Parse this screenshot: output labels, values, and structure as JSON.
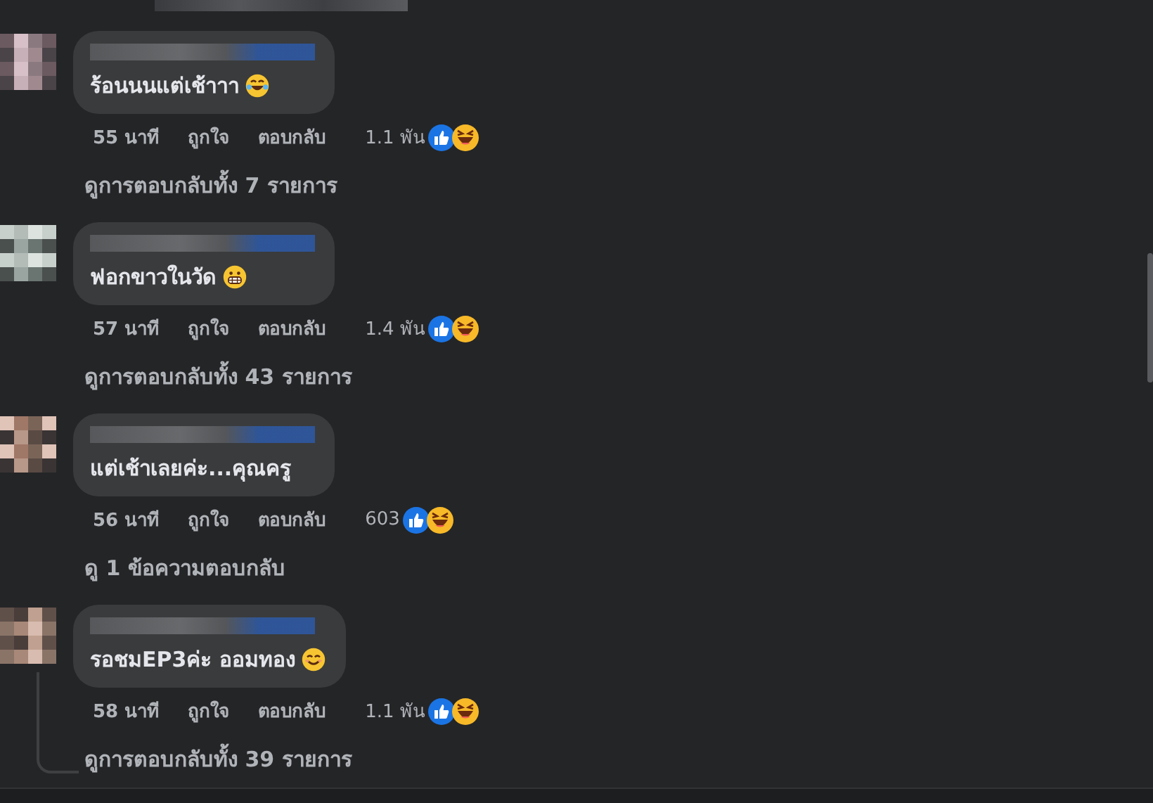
{
  "comments": [
    {
      "text": "ร้อนนนแต่เช้าาา",
      "emoji": {
        "kind": "tears-of-joy"
      },
      "time": "55 นาที",
      "like": "ถูกใจ",
      "reply": "ตอบกลับ",
      "reactions": "1.1 พัน",
      "replies_link": "ดูการตอบกลับทั้ง 7 รายการ",
      "thread_line": false
    },
    {
      "text": "ฟอกขาวในวัด",
      "emoji": {
        "kind": "grimace"
      },
      "time": "57 นาที",
      "like": "ถูกใจ",
      "reply": "ตอบกลับ",
      "reactions": "1.4 พัน",
      "replies_link": "ดูการตอบกลับทั้ง 43 รายการ",
      "thread_line": false
    },
    {
      "text": "แต่เช้าเลยค่ะ...คุณครู",
      "time": "56 นาที",
      "like": "ถูกใจ",
      "reply": "ตอบกลับ",
      "reactions": "603",
      "replies_link": "ดู 1 ข้อความตอบกลับ",
      "thread_line": false
    },
    {
      "text": "รอชมEP3ค่ะ ออมทอง",
      "emoji": {
        "kind": "smile"
      },
      "time": "58 นาที",
      "like": "ถูกใจ",
      "reply": "ตอบกลับ",
      "reactions": "1.1 พัน",
      "replies_link": "ดูการตอบกลับทั้ง 39 รายการ",
      "thread_line": true
    }
  ]
}
